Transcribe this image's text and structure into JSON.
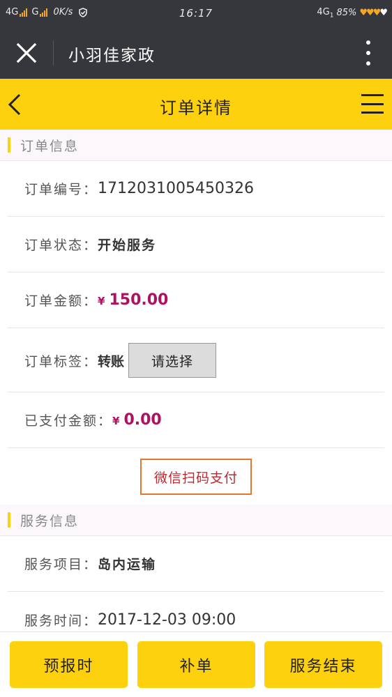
{
  "status_bar": {
    "network1": "4G",
    "network2": "G",
    "speed": "0K/s",
    "time": "16:17",
    "network_right": "4G",
    "sim_slot": "1",
    "battery": "85%"
  },
  "app_bar": {
    "title": "小羽佳家政"
  },
  "header": {
    "title": "订单详情"
  },
  "order_section": {
    "title": "订单信息",
    "order_no_label": "订单编号：",
    "order_no": "1712031005450326",
    "status_label": "订单状态：",
    "status": "开始服务",
    "amount_label": "订单金额：",
    "amount_currency": "¥",
    "amount": "150.00",
    "tag_label": "订单标签：",
    "tag_value": "转账",
    "tag_select": "请选择",
    "paid_label": "已支付金额：",
    "paid_currency": "¥",
    "paid": "0.00",
    "pay_button": "微信扫码支付"
  },
  "service_section": {
    "title": "服务信息",
    "item_label": "服务项目：",
    "item": "岛内运输",
    "time_label": "服务时间：",
    "time": "2017-12-03 09:00"
  },
  "bottom_buttons": {
    "report_time": "预报时",
    "supplement": "补单",
    "finish_service": "服务结束"
  },
  "colors": {
    "brand_yellow": "#fdd10d",
    "dark_bar": "#36373c",
    "money": "#b0115f",
    "pay_border": "#e8762a"
  }
}
